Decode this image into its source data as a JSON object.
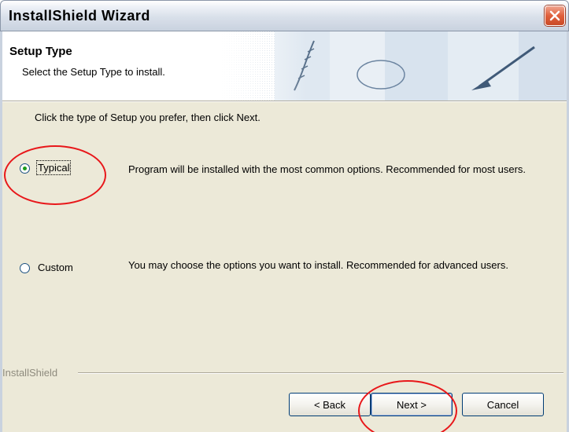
{
  "window": {
    "title": "InstallShield Wizard"
  },
  "header": {
    "title": "Setup Type",
    "subtitle": "Select the Setup Type to install."
  },
  "instruction": "Click the type of Setup you prefer, then click Next.",
  "options": [
    {
      "label": "Typical",
      "selected": true,
      "description": "Program will be installed with the most common options.  Recommended for most users."
    },
    {
      "label": "Custom",
      "selected": false,
      "description": "You may choose the options you want to install. Recommended for advanced users."
    }
  ],
  "branding": "InstallShield",
  "buttons": {
    "back": "< Back",
    "next": "Next >",
    "cancel": "Cancel"
  },
  "colors": {
    "annotation": "#e8171a",
    "titlebar": "#d9e0ea",
    "dialog_bg": "#ece9d8",
    "close_button": "#e0603c"
  }
}
